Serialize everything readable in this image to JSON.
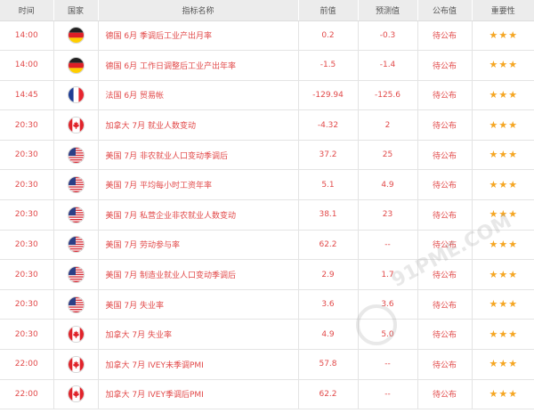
{
  "columns": {
    "time": "时间",
    "country": "国家",
    "indicator": "指标名称",
    "previous": "前值",
    "forecast": "预测值",
    "published": "公布值",
    "importance": "重要性"
  },
  "rows": [
    {
      "time": "14:00",
      "country_flag": "germany-flag-icon",
      "indicator": "德国 6月 季调后工业产出月率",
      "previous": "0.2",
      "forecast": "-0.3",
      "published": "待公布",
      "stars": 3
    },
    {
      "time": "14:00",
      "country_flag": "germany-flag-icon",
      "indicator": "德国 6月 工作日调整后工业产出年率",
      "previous": "-1.5",
      "forecast": "-1.4",
      "published": "待公布",
      "stars": 3
    },
    {
      "time": "14:45",
      "country_flag": "france-flag-icon",
      "indicator": "法国 6月 贸易帐",
      "previous": "-129.94",
      "forecast": "-125.6",
      "published": "待公布",
      "stars": 3
    },
    {
      "time": "20:30",
      "country_flag": "canada-flag-icon",
      "indicator": "加拿大 7月 就业人数变动",
      "previous": "-4.32",
      "forecast": "2",
      "published": "待公布",
      "stars": 3
    },
    {
      "time": "20:30",
      "country_flag": "usa-flag-icon",
      "indicator": "美国 7月 非农就业人口变动季调后",
      "previous": "37.2",
      "forecast": "25",
      "published": "待公布",
      "stars": 3
    },
    {
      "time": "20:30",
      "country_flag": "usa-flag-icon",
      "indicator": "美国 7月 平均每小时工资年率",
      "previous": "5.1",
      "forecast": "4.9",
      "published": "待公布",
      "stars": 3
    },
    {
      "time": "20:30",
      "country_flag": "usa-flag-icon",
      "indicator": "美国 7月 私营企业非农就业人数变动",
      "previous": "38.1",
      "forecast": "23",
      "published": "待公布",
      "stars": 3
    },
    {
      "time": "20:30",
      "country_flag": "usa-flag-icon",
      "indicator": "美国 7月 劳动参与率",
      "previous": "62.2",
      "forecast": "--",
      "published": "待公布",
      "stars": 3
    },
    {
      "time": "20:30",
      "country_flag": "usa-flag-icon",
      "indicator": "美国 7月 制造业就业人口变动季调后",
      "previous": "2.9",
      "forecast": "1.7",
      "published": "待公布",
      "stars": 3
    },
    {
      "time": "20:30",
      "country_flag": "usa-flag-icon",
      "indicator": "美国 7月 失业率",
      "previous": "3.6",
      "forecast": "3.6",
      "published": "待公布",
      "stars": 3
    },
    {
      "time": "20:30",
      "country_flag": "canada-flag-icon",
      "indicator": "加拿大 7月 失业率",
      "previous": "4.9",
      "forecast": "5.0",
      "published": "待公布",
      "stars": 3
    },
    {
      "time": "22:00",
      "country_flag": "canada-flag-icon",
      "indicator": "加拿大 7月 IVEY未季调PMI",
      "previous": "57.8",
      "forecast": "--",
      "published": "待公布",
      "stars": 3
    },
    {
      "time": "22:00",
      "country_flag": "canada-flag-icon",
      "indicator": "加拿大 7月 IVEY季调后PMI",
      "previous": "62.2",
      "forecast": "--",
      "published": "待公布",
      "stars": 3
    }
  ],
  "watermark": "91PME.COM",
  "colors": {
    "text_red": "#e24a4a",
    "header_bg": "#ececec",
    "star": "#f5a623"
  }
}
